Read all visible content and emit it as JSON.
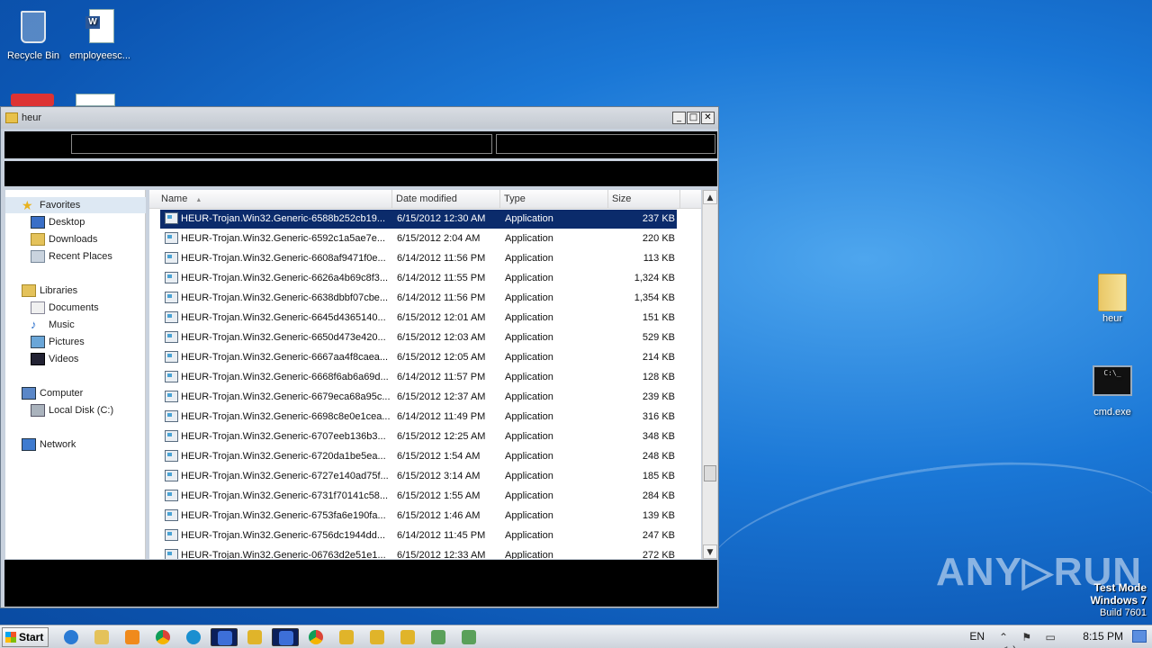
{
  "desktop": {
    "icons": [
      {
        "label": "Recycle Bin",
        "icon": "recycle-bin-icon"
      },
      {
        "label": "employeesc...",
        "icon": "word-document-icon"
      },
      {
        "label": "heur",
        "icon": "folder-icon"
      },
      {
        "label": "cmd.exe",
        "icon": "cmd-icon"
      }
    ]
  },
  "window": {
    "title": "heur",
    "buttons": {
      "minimize": "_",
      "maximize": "□",
      "close": "✕"
    }
  },
  "nav": {
    "favorites": "Favorites",
    "desktop": "Desktop",
    "downloads": "Downloads",
    "recent": "Recent Places",
    "libraries": "Libraries",
    "documents": "Documents",
    "music": "Music",
    "pictures": "Pictures",
    "videos": "Videos",
    "computer": "Computer",
    "local_disk": "Local Disk (C:)",
    "network": "Network"
  },
  "columns": {
    "name": "Name",
    "date": "Date modified",
    "type": "Type",
    "size": "Size"
  },
  "files": [
    {
      "name": "HEUR-Trojan.Win32.Generic-6588b252cb19...",
      "date": "6/15/2012 12:30 AM",
      "type": "Application",
      "size": "237 KB"
    },
    {
      "name": "HEUR-Trojan.Win32.Generic-6592c1a5ae7e...",
      "date": "6/15/2012 2:04 AM",
      "type": "Application",
      "size": "220 KB"
    },
    {
      "name": "HEUR-Trojan.Win32.Generic-6608af9471f0e...",
      "date": "6/14/2012 11:56 PM",
      "type": "Application",
      "size": "113 KB"
    },
    {
      "name": "HEUR-Trojan.Win32.Generic-6626a4b69c8f3...",
      "date": "6/14/2012 11:55 PM",
      "type": "Application",
      "size": "1,324 KB"
    },
    {
      "name": "HEUR-Trojan.Win32.Generic-6638dbbf07cbe...",
      "date": "6/14/2012 11:56 PM",
      "type": "Application",
      "size": "1,354 KB"
    },
    {
      "name": "HEUR-Trojan.Win32.Generic-6645d4365140...",
      "date": "6/15/2012 12:01 AM",
      "type": "Application",
      "size": "151 KB"
    },
    {
      "name": "HEUR-Trojan.Win32.Generic-6650d473e420...",
      "date": "6/15/2012 12:03 AM",
      "type": "Application",
      "size": "529 KB"
    },
    {
      "name": "HEUR-Trojan.Win32.Generic-6667aa4f8caea...",
      "date": "6/15/2012 12:05 AM",
      "type": "Application",
      "size": "214 KB"
    },
    {
      "name": "HEUR-Trojan.Win32.Generic-6668f6ab6a69d...",
      "date": "6/14/2012 11:57 PM",
      "type": "Application",
      "size": "128 KB"
    },
    {
      "name": "HEUR-Trojan.Win32.Generic-6679eca68a95c...",
      "date": "6/15/2012 12:37 AM",
      "type": "Application",
      "size": "239 KB"
    },
    {
      "name": "HEUR-Trojan.Win32.Generic-6698c8e0e1cea...",
      "date": "6/14/2012 11:49 PM",
      "type": "Application",
      "size": "316 KB"
    },
    {
      "name": "HEUR-Trojan.Win32.Generic-6707eeb136b3...",
      "date": "6/15/2012 12:25 AM",
      "type": "Application",
      "size": "348 KB"
    },
    {
      "name": "HEUR-Trojan.Win32.Generic-6720da1be5ea...",
      "date": "6/15/2012 1:54 AM",
      "type": "Application",
      "size": "248 KB"
    },
    {
      "name": "HEUR-Trojan.Win32.Generic-6727e140ad75f...",
      "date": "6/15/2012 3:14 AM",
      "type": "Application",
      "size": "185 KB"
    },
    {
      "name": "HEUR-Trojan.Win32.Generic-6731f70141c58...",
      "date": "6/15/2012 1:55 AM",
      "type": "Application",
      "size": "284 KB"
    },
    {
      "name": "HEUR-Trojan.Win32.Generic-6753fa6e190fa...",
      "date": "6/15/2012 1:46 AM",
      "type": "Application",
      "size": "139 KB"
    },
    {
      "name": "HEUR-Trojan.Win32.Generic-6756dc1944dd...",
      "date": "6/14/2012 11:45 PM",
      "type": "Application",
      "size": "247 KB"
    },
    {
      "name": "HEUR-Trojan.Win32.Generic-06763d2e51e1...",
      "date": "6/15/2012 12:33 AM",
      "type": "Application",
      "size": "272 KB"
    }
  ],
  "watermark": {
    "text": "ANY▷RUN"
  },
  "testmode": {
    "line1": "Test Mode",
    "line2": "Windows 7",
    "line3": "Build 7601"
  },
  "taskbar": {
    "start": "Start",
    "lang": "EN",
    "tray_icons": "⌃ ⚑ ▭ ◁)",
    "clock": "8:15 PM"
  },
  "colors": {
    "selection": "#0b2b6b",
    "desktop": "#1a77d6"
  }
}
